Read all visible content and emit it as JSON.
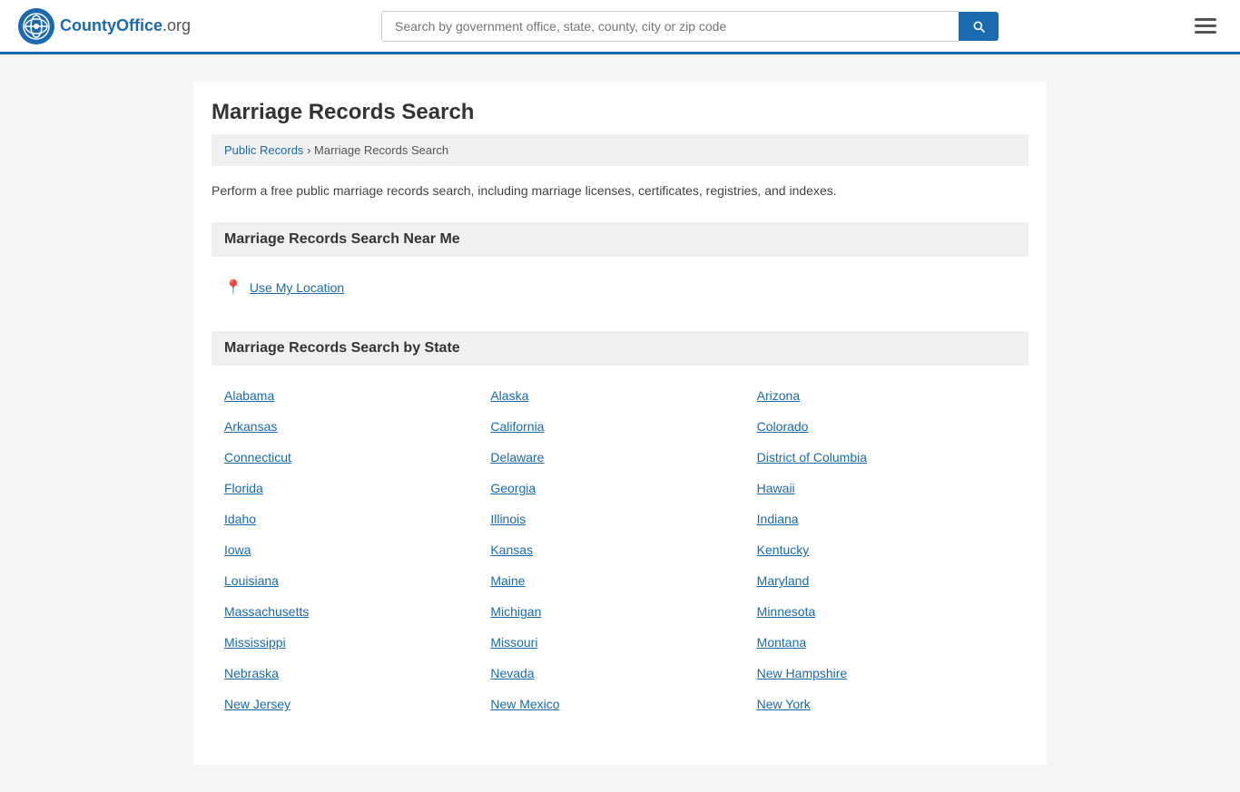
{
  "header": {
    "logo_text": "CountyOffice",
    "logo_suffix": ".org",
    "search_placeholder": "Search by government office, state, county, city or zip code",
    "menu_label": "Menu"
  },
  "page": {
    "title": "Marriage Records Search",
    "breadcrumb_home": "Public Records",
    "breadcrumb_current": "Marriage Records Search",
    "description": "Perform a free public marriage records search, including marriage licenses, certificates, registries, and indexes.",
    "near_me_section": "Marriage Records Search Near Me",
    "use_location_text": "Use My Location",
    "by_state_section": "Marriage Records Search by State"
  },
  "states": [
    "Alabama",
    "Alaska",
    "Arizona",
    "Arkansas",
    "California",
    "Colorado",
    "Connecticut",
    "Delaware",
    "District of Columbia",
    "Florida",
    "Georgia",
    "Hawaii",
    "Idaho",
    "Illinois",
    "Indiana",
    "Iowa",
    "Kansas",
    "Kentucky",
    "Louisiana",
    "Maine",
    "Maryland",
    "Massachusetts",
    "Michigan",
    "Minnesota",
    "Mississippi",
    "Missouri",
    "Montana",
    "Nebraska",
    "Nevada",
    "New Hampshire",
    "New Jersey",
    "New Mexico",
    "New York"
  ]
}
